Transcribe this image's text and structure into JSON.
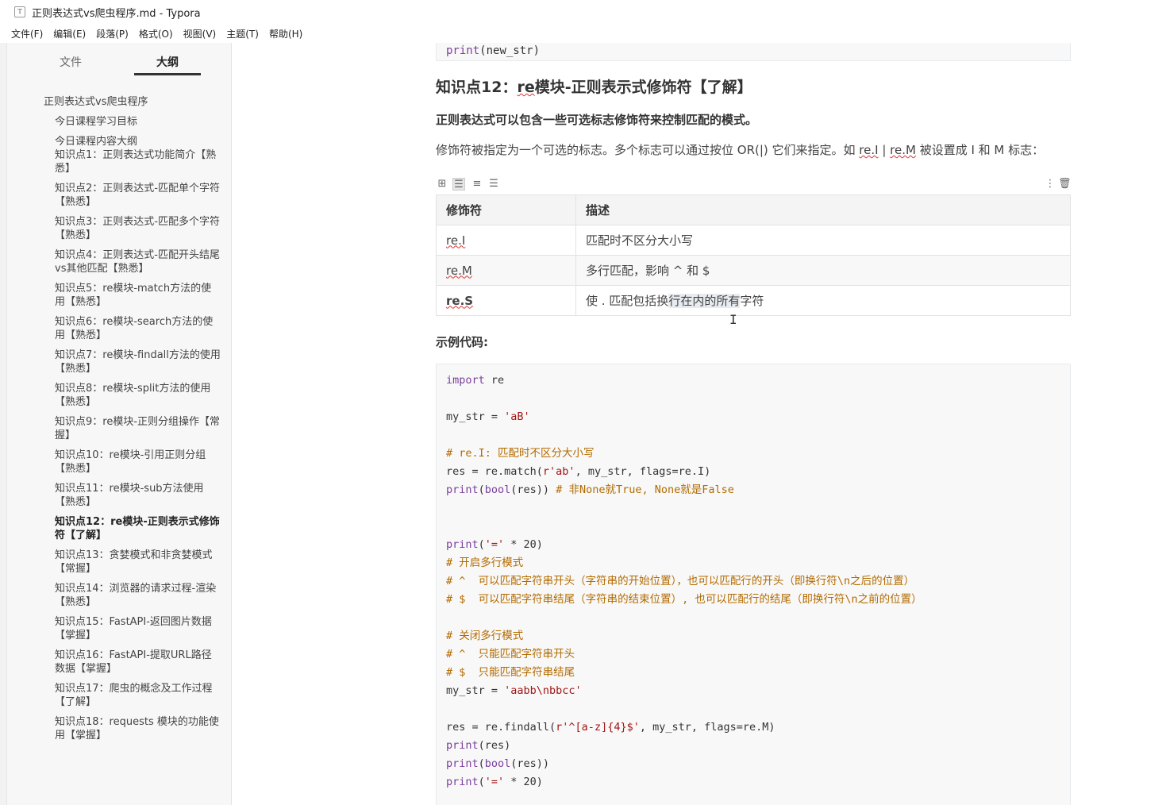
{
  "window": {
    "title": "正则表达式vs爬虫程序.md - Typora",
    "icon": "T"
  },
  "menu": [
    "文件(F)",
    "编辑(E)",
    "段落(P)",
    "格式(O)",
    "视图(V)",
    "主题(T)",
    "帮助(H)"
  ],
  "sidebar": {
    "tabs": {
      "files": "文件",
      "outline": "大纲"
    },
    "outline": [
      {
        "text": "正则表达式vs爬虫程序",
        "level": 1
      },
      {
        "text": "今日课程学习目标",
        "level": 2
      },
      {
        "text": "今日课程内容大纲",
        "level": 2
      },
      {
        "text": "知识点1：正则表达式功能简介【熟悉】",
        "level": 2
      },
      {
        "text": "知识点2：正则表达式-匹配单个字符【熟悉】",
        "level": 2
      },
      {
        "text": "知识点3：正则表达式-匹配多个字符【熟悉】",
        "level": 2
      },
      {
        "text": "知识点4：正则表达式-匹配开头结尾vs其他匹配【熟悉】",
        "level": 2
      },
      {
        "text": "知识点5：re模块-match方法的使用【熟悉】",
        "level": 2
      },
      {
        "text": "知识点6：re模块-search方法的使用【熟悉】",
        "level": 2
      },
      {
        "text": "知识点7：re模块-findall方法的使用【熟悉】",
        "level": 2
      },
      {
        "text": "知识点8：re模块-split方法的使用【熟悉】",
        "level": 2
      },
      {
        "text": "知识点9：re模块-正则分组操作【常握】",
        "level": 2
      },
      {
        "text": "知识点10：re模块-引用正则分组【熟悉】",
        "level": 2
      },
      {
        "text": "知识点11：re模块-sub方法使用【熟悉】",
        "level": 2
      },
      {
        "text": "知识点12：re模块-正则表示式修饰符【了解】",
        "level": 2,
        "active": true
      },
      {
        "text": "知识点13：贪婪模式和非贪婪模式【常握】",
        "level": 2
      },
      {
        "text": "知识点14：浏览器的请求过程-渲染【熟悉】",
        "level": 2
      },
      {
        "text": "知识点15：FastAPI-返回图片数据【掌握】",
        "level": 2
      },
      {
        "text": "知识点16：FastAPI-提取URL路径数据【掌握】",
        "level": 2
      },
      {
        "text": "知识点17：爬虫的概念及工作过程【了解】",
        "level": 2
      },
      {
        "text": "知识点18：requests 模块的功能使用【掌握】",
        "level": 2
      }
    ]
  },
  "doc": {
    "top_code": "print(new_str)",
    "heading": {
      "prefix": "知识点12：",
      "re": "re",
      "rest": "模块-正则表示式修饰符【了解】"
    },
    "subheading": "正则表达式可以包含一些可选标志修饰符来控制匹配的模式。",
    "para": {
      "p1": "修饰符被指定为一个可选的标志。多个标志可以通过按位 OR(|) 它们来指定。如 ",
      "c1": "re.I",
      "p2": " | ",
      "c2": "re.M",
      "p3": " 被设置成 I 和 M 标志："
    },
    "table": {
      "headers": [
        "修饰符",
        "描述"
      ],
      "rows": [
        {
          "flag": "re.I",
          "desc": "匹配时不区分大小写"
        },
        {
          "flag": "re.M",
          "desc": "多行匹配，影响 ^ 和 $"
        },
        {
          "flag": "re.S",
          "desc_a": "使 . 匹配包括换",
          "desc_b": "行在内的所有",
          "desc_c": "字符"
        }
      ]
    },
    "example_label": "示例代码:",
    "code": {
      "l1_kw": "import",
      "l1_rest": " re",
      "l3_a": "my_str = ",
      "l3_s": "'aB'",
      "l5_c": "# re.I: 匹配时不区分大小写",
      "l6_a": "res = re.match(",
      "l6_s": "r'ab'",
      "l6_b": ", my_str, flags=re.I)",
      "l7_kw": "print",
      "l7_a": "(",
      "l7_kw2": "bool",
      "l7_b": "(res)) ",
      "l7_c": "# 非None就True, None就是False",
      "l10_kw": "print",
      "l10_a": "(",
      "l10_s": "'='",
      "l10_b": " * 20)",
      "l11_c": "# 开启多行模式",
      "l12_c": "# ^  可以匹配字符串开头（字符串的开始位置），也可以匹配行的开头（即换行符\\n之后的位置）",
      "l13_c": "# $  可以匹配字符串结尾（字符串的结束位置）, 也可以匹配行的结尾（即换行符\\n之前的位置）",
      "l15_c": "# 关闭多行模式",
      "l16_c": "# ^  只能匹配字符串开头",
      "l17_c": "# $  只能匹配字符串结尾",
      "l18_a": "my_str = ",
      "l18_s": "'aabb\\nbbcc'",
      "l20_a": "res = re.findall(",
      "l20_s": "r'^[a-z]{4}$'",
      "l20_b": ", my_str, flags=re.M)",
      "l21_kw": "print",
      "l21_a": "(res)",
      "l22_kw": "print",
      "l22_a": "(",
      "l22_kw2": "bool",
      "l22_b": "(res))",
      "l23_kw": "print",
      "l23_a": "(",
      "l23_s": "'='",
      "l23_b": " * 20)"
    }
  },
  "colors": {
    "keyword": "#7a3e9d",
    "string": "#a31515",
    "comment": "#b36b00",
    "spellcheck": "#d33"
  }
}
